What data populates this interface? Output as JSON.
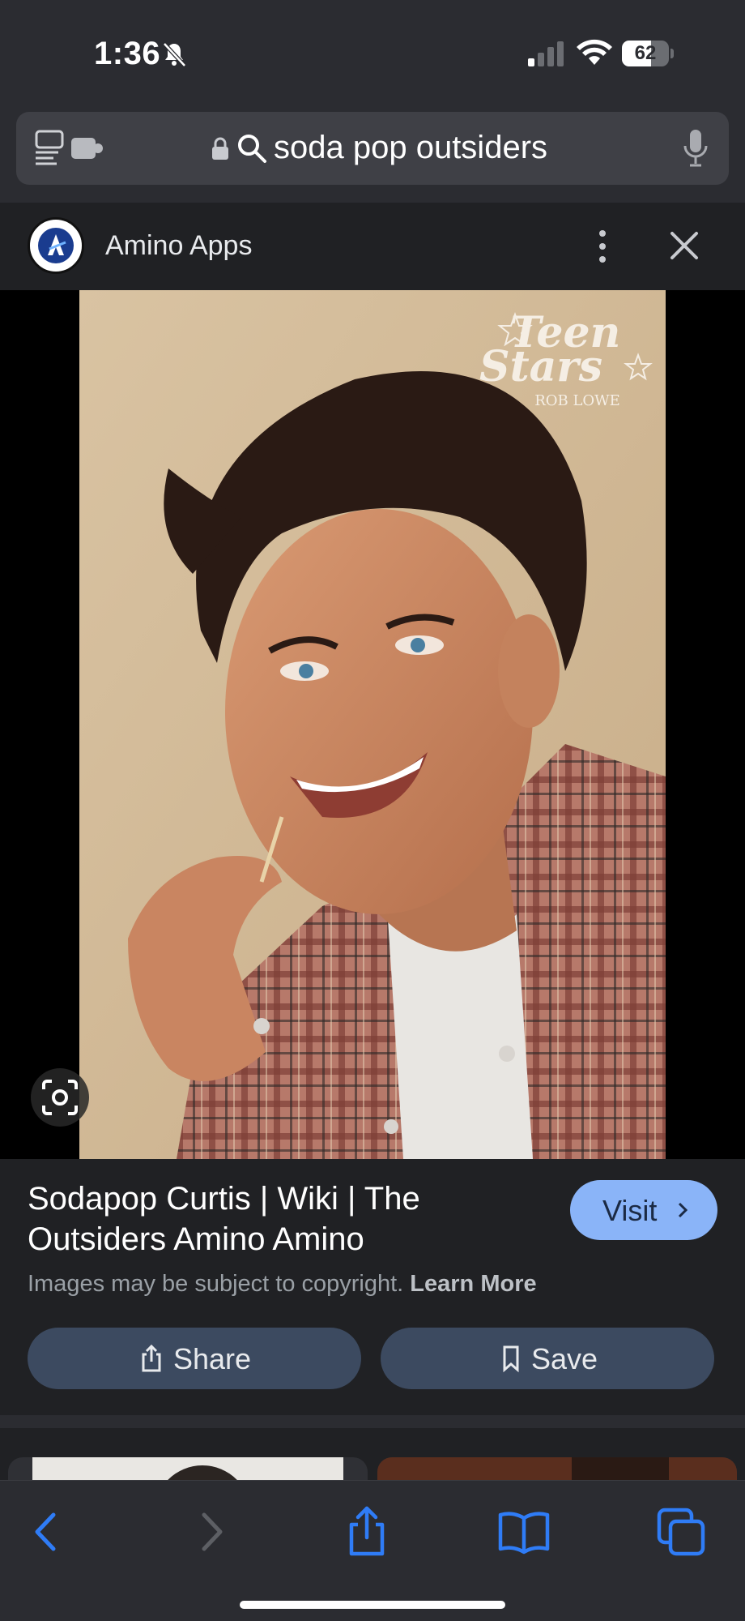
{
  "status_bar": {
    "time": "1:36",
    "battery": "62",
    "battery_level": 0.62
  },
  "url_bar": {
    "query": "soda pop outsiders"
  },
  "source": {
    "name": "Amino Apps"
  },
  "image": {
    "overlay_title_line1": "Teen",
    "overlay_title_line2": "Stars",
    "overlay_subtitle": "ROB LOWE"
  },
  "result": {
    "title": "Sodapop Curtis | Wiki | The Outsiders Amino Amino",
    "visit_label": "Visit",
    "copyright_text": "Images may be subject to copyright.",
    "learn_more": "Learn More",
    "share_label": "Share",
    "save_label": "Save"
  },
  "colors": {
    "accent": "#8ab4f8",
    "panel": "#202124",
    "chrome": "#2b2c31",
    "button": "#3c4a60",
    "toolbar_icon": "#2f7cf6"
  },
  "icons": {
    "status": [
      "bell-slash-icon",
      "cellular-signal-icon",
      "wifi-icon",
      "battery-icon"
    ],
    "url_bar": [
      "reader-view-icon",
      "extension-icon",
      "lock-icon",
      "search-icon",
      "microphone-icon"
    ],
    "toolbar": [
      "back-icon",
      "forward-icon",
      "share-icon",
      "bookmarks-icon",
      "tabs-icon"
    ]
  }
}
